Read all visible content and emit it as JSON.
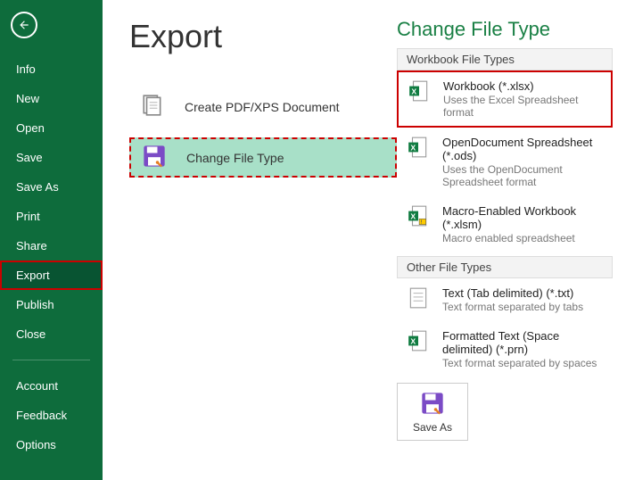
{
  "sidebar": {
    "items": [
      {
        "label": "Info"
      },
      {
        "label": "New"
      },
      {
        "label": "Open"
      },
      {
        "label": "Save"
      },
      {
        "label": "Save As"
      },
      {
        "label": "Print"
      },
      {
        "label": "Share"
      },
      {
        "label": "Export"
      },
      {
        "label": "Publish"
      },
      {
        "label": "Close"
      },
      {
        "label": "Account"
      },
      {
        "label": "Feedback"
      },
      {
        "label": "Options"
      }
    ]
  },
  "page": {
    "title": "Export"
  },
  "options": {
    "pdf": "Create PDF/XPS Document",
    "change": "Change File Type"
  },
  "right": {
    "title": "Change File Type",
    "group_workbook": "Workbook File Types",
    "group_other": "Other File Types",
    "types": {
      "xlsx": {
        "title": "Workbook (*.xlsx)",
        "desc": "Uses the Excel Spreadsheet format"
      },
      "ods": {
        "title": "OpenDocument Spreadsheet (*.ods)",
        "desc": "Uses the OpenDocument Spreadsheet format"
      },
      "xlsm": {
        "title": "Macro-Enabled Workbook (*.xlsm)",
        "desc": "Macro enabled spreadsheet"
      },
      "txt": {
        "title": "Text (Tab delimited) (*.txt)",
        "desc": "Text format separated by tabs"
      },
      "prn": {
        "title": "Formatted Text (Space delimited) (*.prn)",
        "desc": "Text format separated by spaces"
      }
    },
    "saveas": "Save As"
  },
  "colors": {
    "brand": "#0e6c3c",
    "highlight": "#c00"
  }
}
